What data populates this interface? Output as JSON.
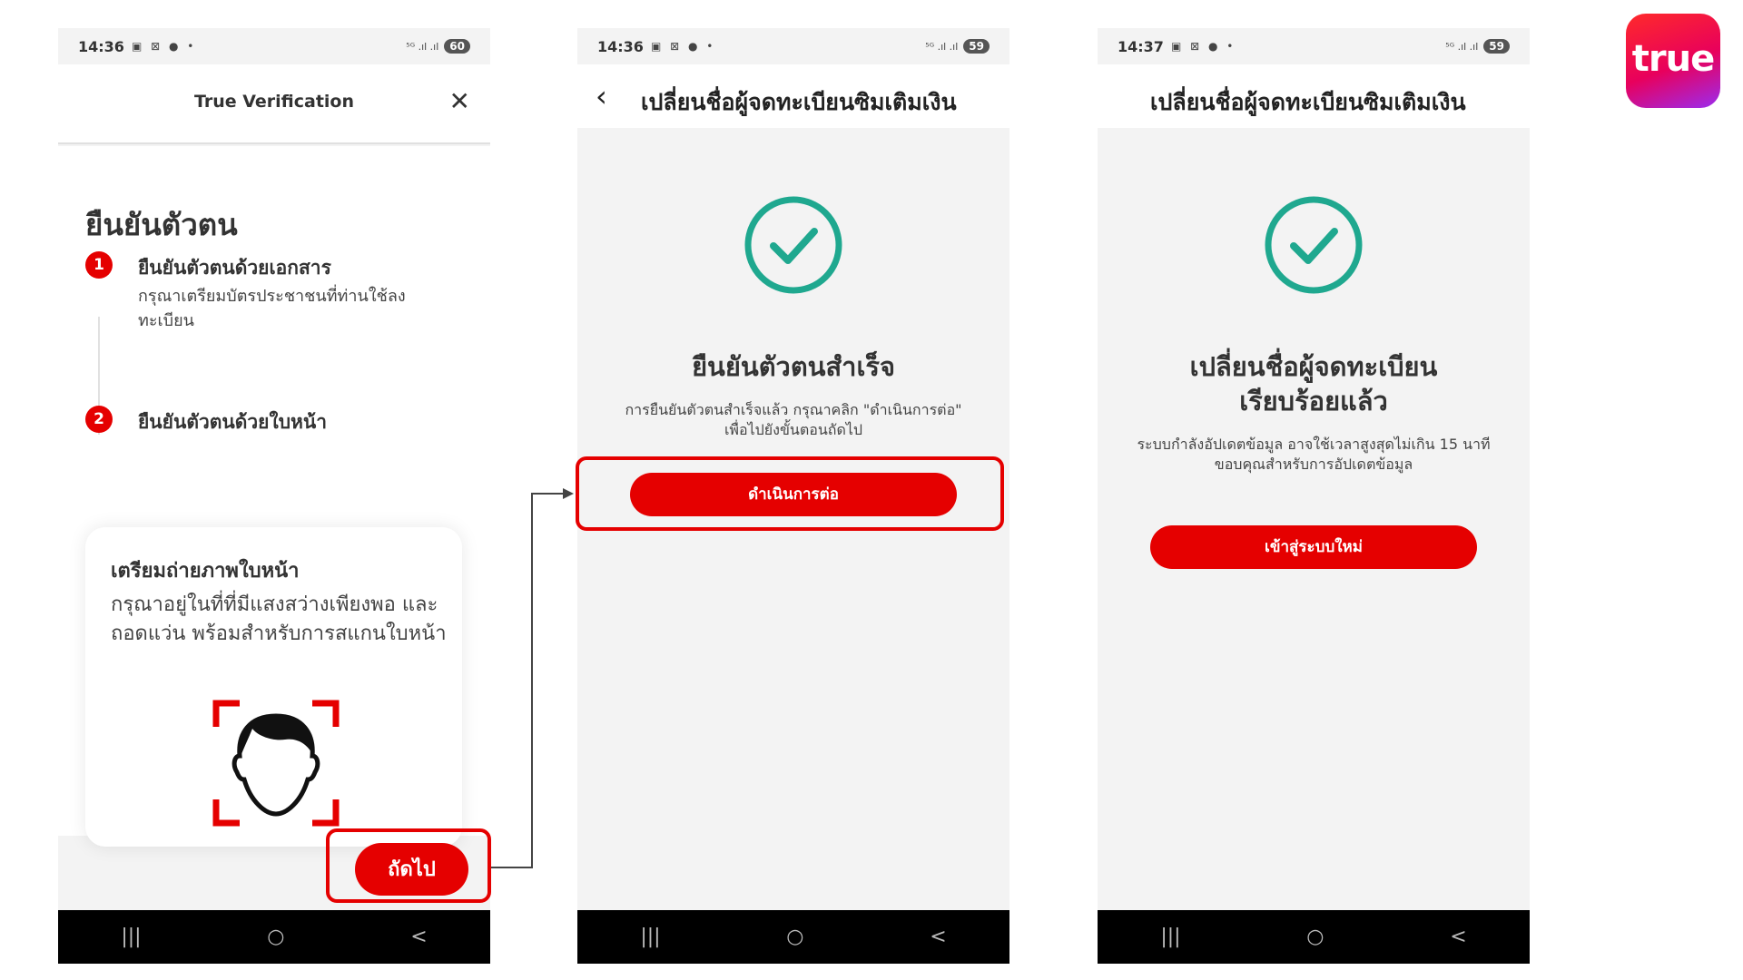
{
  "brand": {
    "logo_text": "true",
    "accent": "#e50000"
  },
  "phone1": {
    "status": {
      "time": "14:36",
      "icons": "▣ ⊠ ● •",
      "network": "⁵ᴳ .ıl .ıl",
      "battery": "60"
    },
    "header_title": "True Verification",
    "heading": "ยืนยันตัวตน",
    "steps": [
      {
        "num": "1",
        "title": "ยืนยันตัวตนด้วยเอกสาร",
        "desc": "กรุณาเตรียมบัตรประชาชนที่ท่านใช้ลงทะเบียน"
      },
      {
        "num": "2",
        "title": "ยืนยันตัวตนด้วยใบหน้า"
      }
    ],
    "card": {
      "title": "เตรียมถ่ายภาพใบหน้า",
      "desc": "กรุณาอยู่ในที่ที่มีแสงสว่างเพียงพอ และถอดแว่น พร้อมสำหรับการสแกนใบหน้า"
    },
    "next_button": "ถัดไป"
  },
  "phone2": {
    "status": {
      "time": "14:36",
      "icons": "▣ ⊠ ● •",
      "network": "⁵ᴳ .ıl .ıl",
      "battery": "59"
    },
    "header_title": "เปลี่ยนชื่อผู้จดทะเบียนซิมเติมเงิน",
    "heading": "ยืนยันตัวตนสำเร็จ",
    "desc": "การยืนยันตัวตนสำเร็จแล้ว กรุณาคลิก \"ดำเนินการต่อ\" เพื่อไปยังขั้นตอนถัดไป",
    "button": "ดำเนินการต่อ"
  },
  "phone3": {
    "status": {
      "time": "14:37",
      "icons": "▣ ⊠ ● •",
      "network": "⁵ᴳ .ıl .ıl",
      "battery": "59"
    },
    "header_title": "เปลี่ยนชื่อผู้จดทะเบียนซิมเติมเงิน",
    "heading_line1": "เปลี่ยนชื่อผู้จดทะเบียน",
    "heading_line2": "เรียบร้อยแล้ว",
    "desc": "ระบบกำลังอัปเดตข้อมูล อาจใช้เวลาสูงสุดไม่เกิน 15 นาที ขอบคุณสำหรับการอัปเดตข้อมูล",
    "button": "เข้าสู่ระบบใหม่"
  },
  "navbar": {
    "recents": "|||",
    "home": "○",
    "back": "<"
  }
}
